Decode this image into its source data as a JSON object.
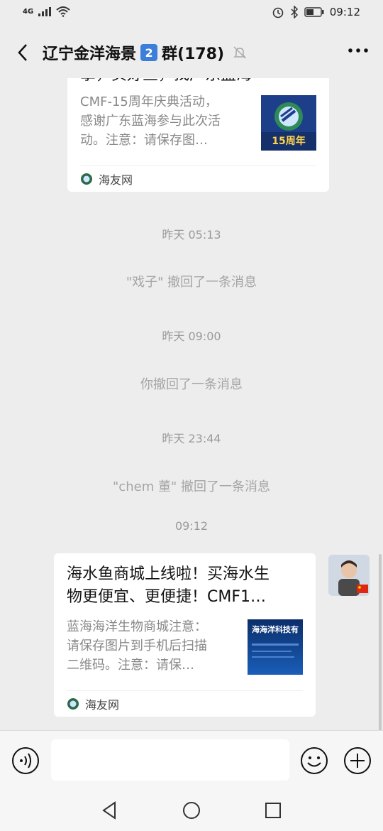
{
  "status_bar": {
    "network": "4G",
    "time": "09:12"
  },
  "header": {
    "title": "辽宁金洋海景",
    "badge": "2",
    "suffix": "群(178)"
  },
  "messages": {
    "card1": {
      "title_partial": "拿，买好鱼，找广东蓝海",
      "desc_lines": [
        "CMF-15周年庆典活动，",
        "感谢广东蓝海参与此次活",
        "动。注意：请保存图…"
      ],
      "thumb_text": "15周年",
      "source": "海友网"
    },
    "t1": "昨天 05:13",
    "s1": "\"戏子\" 撤回了一条消息",
    "t2": "昨天 09:00",
    "s2": "你撤回了一条消息",
    "t3": "昨天 23:44",
    "s3": "\"chem 董\" 撤回了一条消息",
    "t4": "09:12",
    "card2": {
      "title_lines": [
        "海水鱼商城上线啦！买海水生",
        "物更便宜、更便捷！CMF1…"
      ],
      "desc_lines": [
        "蓝海海洋生物商城注意：",
        "请保存图片到手机后扫描",
        "二维码。注意：请保…"
      ],
      "thumb_text": "海海洋科技有",
      "source": "海友网"
    }
  },
  "input": {
    "placeholder": ""
  },
  "colors": {
    "background": "#ededed",
    "accent": "#3d7edb"
  }
}
